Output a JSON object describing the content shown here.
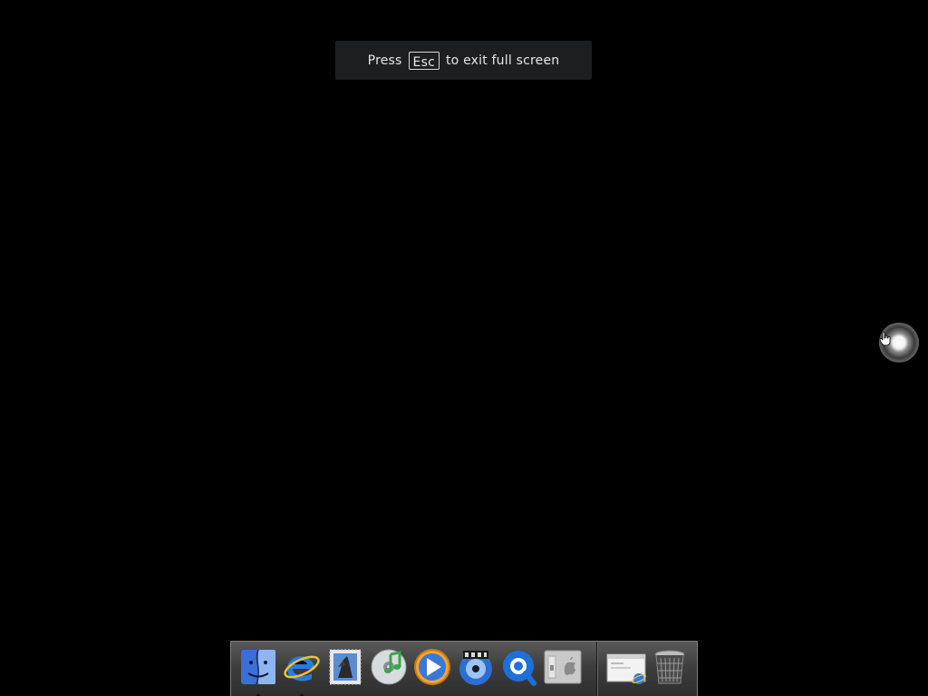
{
  "banner": {
    "prefix": "Press",
    "key": "Esc",
    "suffix": "to exit full screen"
  },
  "dock": {
    "items": [
      {
        "name": "Finder",
        "icon": "finder-icon",
        "running": true
      },
      {
        "name": "Internet Explorer",
        "icon": "internet-explorer-icon",
        "running": true
      },
      {
        "name": "Mail",
        "icon": "mail-stamp-icon",
        "running": false
      },
      {
        "name": "iTunes",
        "icon": "itunes-icon",
        "running": false
      },
      {
        "name": "Windows Media Player",
        "icon": "media-player-icon",
        "running": false
      },
      {
        "name": "iDVD",
        "icon": "dvd-icon",
        "running": false
      },
      {
        "name": "QuickTime Player",
        "icon": "quicktime-icon",
        "running": false
      },
      {
        "name": "System Preferences",
        "icon": "system-preferences-icon",
        "running": false
      },
      {
        "name": "Minimized Internet Explorer window",
        "icon": "minimized-window-icon",
        "running": false
      },
      {
        "name": "Trash",
        "icon": "trash-icon",
        "running": false
      }
    ]
  },
  "colors": {
    "background": "#000000",
    "banner_bg": "#1c1f22",
    "banner_text": "#e6e6e6"
  }
}
